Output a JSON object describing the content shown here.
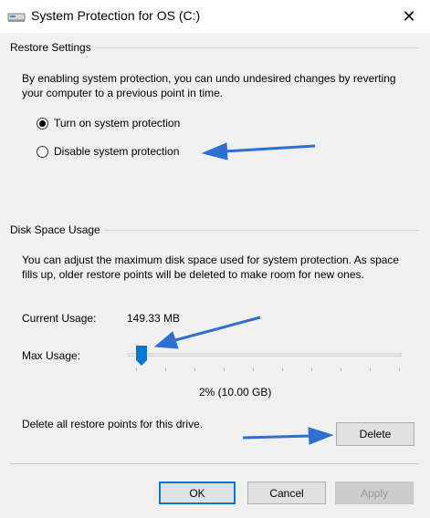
{
  "window": {
    "title": "System Protection for OS (C:)",
    "close_glyph": "✕",
    "icon": "drive-icon"
  },
  "restore_settings": {
    "heading": "Restore Settings",
    "description": "By enabling system protection, you can undo undesired changes by reverting your computer to a previous point in time.",
    "options": [
      {
        "label": "Turn on system protection",
        "selected": true
      },
      {
        "label": "Disable system protection",
        "selected": false
      }
    ]
  },
  "disk_space": {
    "heading": "Disk Space Usage",
    "description": "You can adjust the maximum disk space used for system protection. As space fills up, older restore points will be deleted to make room for new ones.",
    "current_usage_label": "Current Usage:",
    "current_usage_value": "149.33 MB",
    "max_usage_label": "Max Usage:",
    "max_usage_value": "2% (10.00 GB)",
    "max_usage_percent": 2,
    "delete_text": "Delete all restore points for this drive.",
    "delete_button": "Delete"
  },
  "footer": {
    "ok": "OK",
    "cancel": "Cancel",
    "apply": "Apply"
  },
  "colors": {
    "accent": "#0078d7",
    "annotation_arrow": "#2f6fd0"
  }
}
